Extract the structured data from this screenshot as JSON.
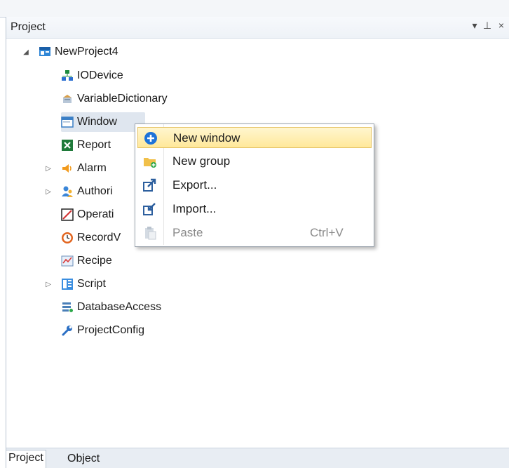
{
  "panel": {
    "title": "Project",
    "pin_glyph": "▾ ⊥ ×"
  },
  "tree": {
    "root": {
      "label": "NewProject4",
      "icon": "project-icon",
      "expanded": true
    },
    "items": [
      {
        "label": "IODevice",
        "icon": "network-icon",
        "expandable": false
      },
      {
        "label": "VariableDictionary",
        "icon": "database-variable-icon",
        "expandable": false
      },
      {
        "label": "Window",
        "icon": "window-icon",
        "expandable": false,
        "selected": true
      },
      {
        "label": "Report",
        "icon": "excel-report-icon",
        "expandable": false
      },
      {
        "label": "Alarm",
        "icon": "alarm-speaker-icon",
        "expandable": true
      },
      {
        "label": "Authori",
        "icon": "users-icon",
        "expandable": true
      },
      {
        "label": "Operati",
        "icon": "operation-log-icon",
        "expandable": false
      },
      {
        "label": "RecordV",
        "icon": "clock-icon",
        "expandable": false
      },
      {
        "label": "Recipe",
        "icon": "recipe-icon",
        "expandable": false
      },
      {
        "label": "Script",
        "icon": "script-icon",
        "expandable": true
      },
      {
        "label": "DatabaseAccess",
        "icon": "database-access-icon",
        "expandable": false
      },
      {
        "label": "ProjectConfig",
        "icon": "wrench-icon",
        "expandable": false
      }
    ]
  },
  "context_menu": {
    "items": [
      {
        "label": "New window",
        "icon": "plus-circle-icon",
        "shortcut": "",
        "highlighted": true,
        "enabled": true
      },
      {
        "label": "New group",
        "icon": "folder-new-icon",
        "shortcut": "",
        "highlighted": false,
        "enabled": true
      },
      {
        "label": "Export...",
        "icon": "export-icon",
        "shortcut": "",
        "highlighted": false,
        "enabled": true
      },
      {
        "label": "Import...",
        "icon": "import-icon",
        "shortcut": "",
        "highlighted": false,
        "enabled": true
      },
      {
        "label": "Paste",
        "icon": "paste-icon",
        "shortcut": "Ctrl+V",
        "highlighted": false,
        "enabled": false
      }
    ]
  },
  "bottom_tabs": [
    {
      "label": "Project",
      "active": true
    },
    {
      "label": "Object",
      "active": false
    }
  ],
  "colors": {
    "selection": "#dfe6ef",
    "menu_highlight": "#ffe89a",
    "accent_blue": "#1e73d8"
  }
}
